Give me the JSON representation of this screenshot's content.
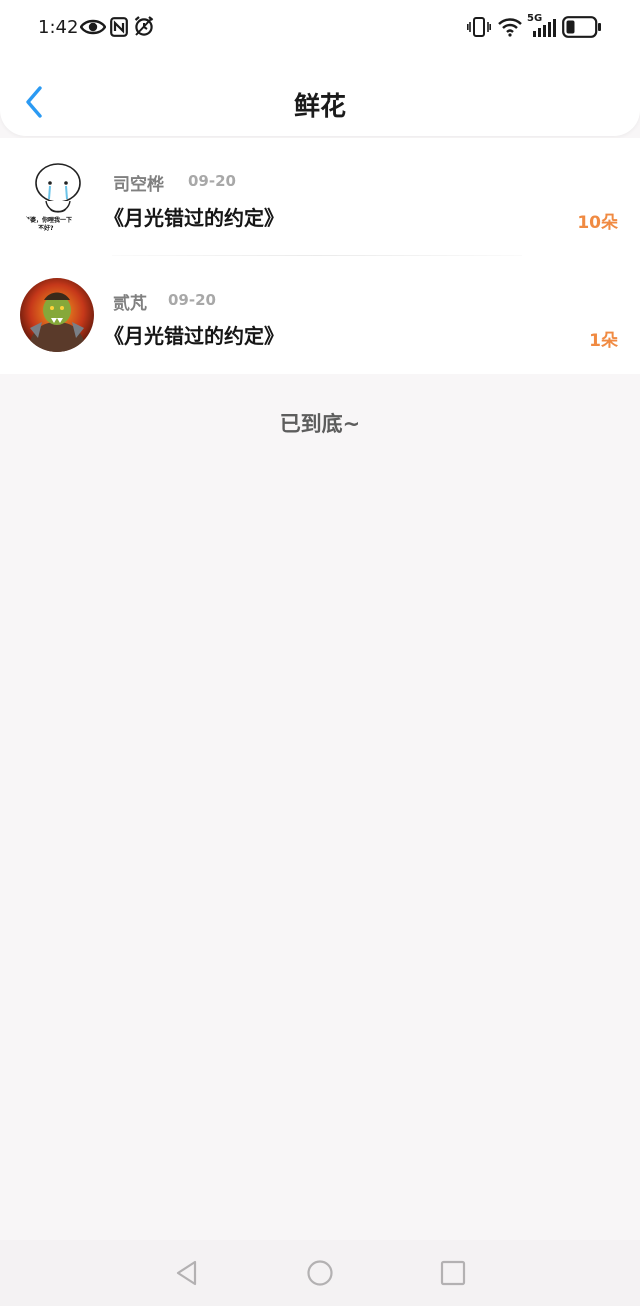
{
  "status_bar": {
    "time": "1:42",
    "left_icons": [
      "eye-icon",
      "nfc-icon",
      "alarm-icon"
    ],
    "right_icons": [
      "vibrate-icon",
      "wifi-icon",
      "signal-5g-icon",
      "battery-icon"
    ],
    "network_label": "5G"
  },
  "header": {
    "title": "鲜花",
    "back_icon": "chevron-left-icon",
    "accent_color": "#2b9af3"
  },
  "records": [
    {
      "user": "司空桦",
      "date": "09-20",
      "title": "《月光错过的约定》",
      "count": "10朵",
      "avatar_caption_1": "老婆，你哩我一下",
      "avatar_caption_2": "不好?"
    },
    {
      "user": "贰芃",
      "date": "09-20",
      "title": "《月光错过的约定》",
      "count": "1朵"
    }
  ],
  "list_end_text": "已到底~",
  "count_color": "#f08a42",
  "system_nav": [
    "back-triangle-icon",
    "home-circle-icon",
    "recents-square-icon"
  ]
}
